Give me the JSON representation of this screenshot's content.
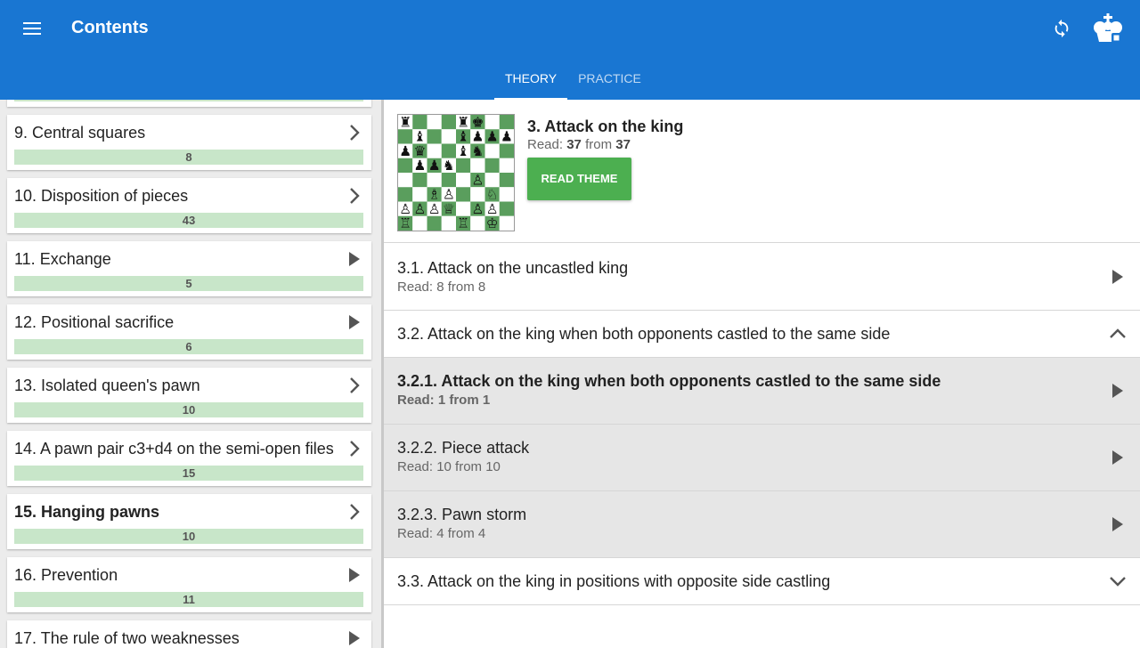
{
  "appbar": {
    "title": "Contents",
    "color": "#1976d2",
    "icons": [
      "menu-icon",
      "sync-icon",
      "king-crown-icon"
    ],
    "tabs": [
      {
        "label": "THEORY",
        "active": true
      },
      {
        "label": "PRACTICE",
        "active": false
      }
    ]
  },
  "sidebar": {
    "items": [
      {
        "label": "9. Central squares",
        "count": "8",
        "arrow": "chevron"
      },
      {
        "label": "10. Disposition of pieces",
        "count": "43",
        "arrow": "chevron"
      },
      {
        "label": "11. Exchange",
        "count": "5",
        "arrow": "play"
      },
      {
        "label": "12. Positional sacrifice",
        "count": "6",
        "arrow": "play"
      },
      {
        "label": "13. Isolated queen's pawn",
        "count": "10",
        "arrow": "chevron"
      },
      {
        "label": "14. A pawn pair c3+d4 on the semi-open files",
        "count": "15",
        "arrow": "chevron"
      },
      {
        "label": "15. Hanging pawns",
        "count": "10",
        "arrow": "chevron",
        "current": true
      },
      {
        "label": "16. Prevention",
        "count": "11",
        "arrow": "play"
      },
      {
        "label": "17. The rule of two weaknesses",
        "count": "",
        "arrow": "play"
      }
    ]
  },
  "theme": {
    "title": "3. Attack on the king",
    "read_prefix": "Read:",
    "read_done": "37",
    "read_mid": "from",
    "read_total": "37",
    "button": "READ THEME",
    "button_color": "#4caf50"
  },
  "board": {
    "light": "#ffffff",
    "dark": "#5a9e5d",
    "rows": [
      [
        [
          "r",
          "b"
        ],
        "",
        "",
        "",
        [
          "r",
          "b"
        ],
        [
          "k",
          "b"
        ],
        "",
        ""
      ],
      [
        "",
        [
          "b",
          "b"
        ],
        "",
        "",
        [
          "b",
          "b"
        ],
        [
          "p",
          "b"
        ],
        [
          "p",
          "b"
        ],
        [
          "p",
          "b"
        ]
      ],
      [
        [
          "p",
          "b"
        ],
        [
          "q",
          "b"
        ],
        "",
        "",
        [
          "b",
          "b"
        ],
        [
          "n",
          "b"
        ],
        "",
        ""
      ],
      [
        "",
        [
          "p",
          "b"
        ],
        [
          "p",
          "b"
        ],
        [
          "n",
          "b"
        ],
        "",
        "",
        "",
        ""
      ],
      [
        "",
        "",
        "",
        "",
        "",
        [
          "p",
          "w"
        ],
        "",
        ""
      ],
      [
        "",
        "",
        [
          "b",
          "w"
        ],
        [
          "p",
          "w"
        ],
        "",
        "",
        [
          "n",
          "w"
        ],
        ""
      ],
      [
        [
          "p",
          "w"
        ],
        [
          "p",
          "w"
        ],
        [
          "p",
          "w"
        ],
        [
          "q",
          "w"
        ],
        "",
        [
          "p",
          "w"
        ],
        [
          "p",
          "w"
        ],
        "",
        ""
      ],
      [
        [
          "r",
          "w"
        ],
        "",
        "",
        "",
        [
          "r",
          "w"
        ],
        "",
        [
          "k",
          "w"
        ],
        ""
      ]
    ]
  },
  "sections": [
    {
      "title": "3.1. Attack on the uncastled king",
      "sub": "Read: 8 from 8",
      "arrow": "play",
      "level": 1
    },
    {
      "title": "3.2. Attack on the king when both opponents castled to the same side",
      "sub": "",
      "arrow": "expand-less",
      "level": 1
    },
    {
      "title": "3.2.1. Attack on the king when both opponents castled to the same side",
      "sub": "Read: 1 from 1",
      "arrow": "play",
      "level": 2,
      "bold": true
    },
    {
      "title": "3.2.2. Piece attack",
      "sub": "Read: 10 from 10",
      "arrow": "play",
      "level": 2
    },
    {
      "title": "3.2.3. Pawn storm",
      "sub": "Read: 4 from 4",
      "arrow": "play",
      "level": 2
    },
    {
      "title": "3.3. Attack on the king in positions with opposite side castling",
      "sub": "",
      "arrow": "expand-more",
      "level": 1
    }
  ]
}
